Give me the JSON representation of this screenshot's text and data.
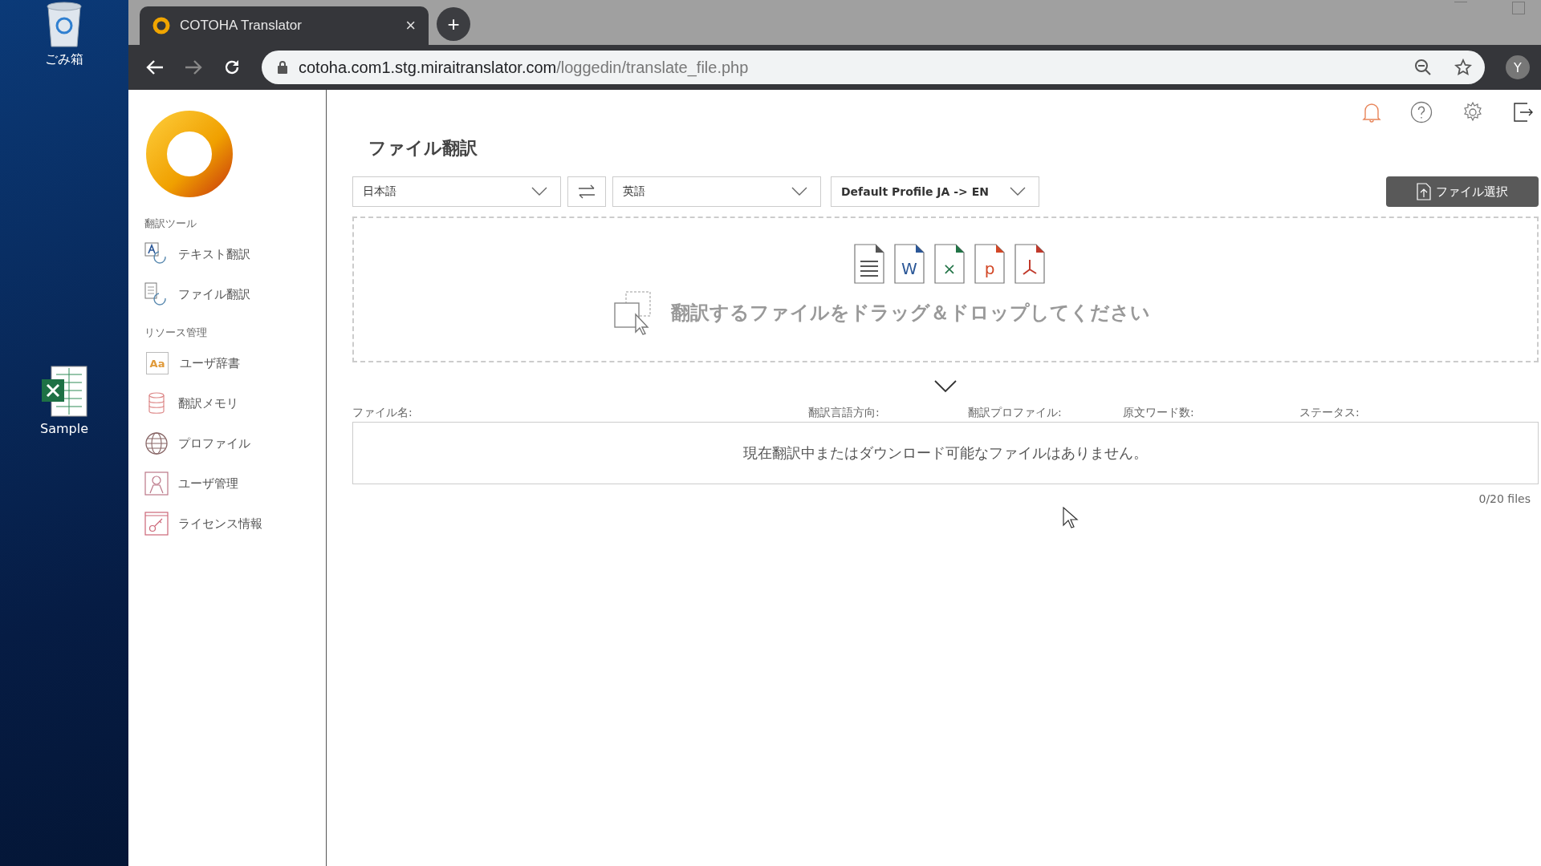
{
  "desktop": {
    "icons": [
      {
        "kind": "recycle",
        "label": "ごみ箱"
      },
      {
        "kind": "excel",
        "label": "Sample"
      }
    ]
  },
  "browser": {
    "tab": {
      "title": "COTOHA Translator",
      "close": "×"
    },
    "new_tab": "+",
    "url_host": "cotoha.com1.stg.miraitranslator.com",
    "url_path": "/loggedin/translate_file.php",
    "profile": "Y"
  },
  "sidebar": {
    "sections": [
      {
        "title": "翻訳ツール",
        "items": [
          {
            "kind": "text",
            "label": "テキスト翻訳"
          },
          {
            "kind": "file",
            "label": "ファイル翻訳"
          }
        ]
      },
      {
        "title": "リソース管理",
        "items": [
          {
            "kind": "dict",
            "label": "ユーザ辞書",
            "icon_text": "Aa"
          },
          {
            "kind": "memory",
            "label": "翻訳メモリ"
          },
          {
            "kind": "globe",
            "label": "プロファイル"
          },
          {
            "kind": "user",
            "label": "ユーザ管理"
          },
          {
            "kind": "license",
            "label": "ライセンス情報"
          }
        ]
      }
    ]
  },
  "page": {
    "title": "ファイル翻訳",
    "source_language": "日本語",
    "target_language": "英語",
    "profile": "Default Profile JA -> EN",
    "file_select_button": "ファイル選択",
    "dropzone_text": "翻訳するファイルをドラッグ＆ドロップしてください",
    "file_types": [
      {
        "kind": "txt",
        "color": "#555555"
      },
      {
        "kind": "word",
        "color": "#2b5797",
        "letter": "W"
      },
      {
        "kind": "excel",
        "color": "#217346",
        "letter": "×"
      },
      {
        "kind": "ppt",
        "color": "#d24726",
        "letter": "p"
      },
      {
        "kind": "pdf",
        "color": "#c0392b"
      }
    ],
    "table": {
      "columns": [
        "ファイル名:",
        "翻訳言語方向:",
        "翻訳プロファイル:",
        "原文ワード数:",
        "ステータス:"
      ],
      "empty_message": "現在翻訳中またはダウンロード可能なファイルはありません。"
    },
    "file_count": "0/20 files"
  }
}
